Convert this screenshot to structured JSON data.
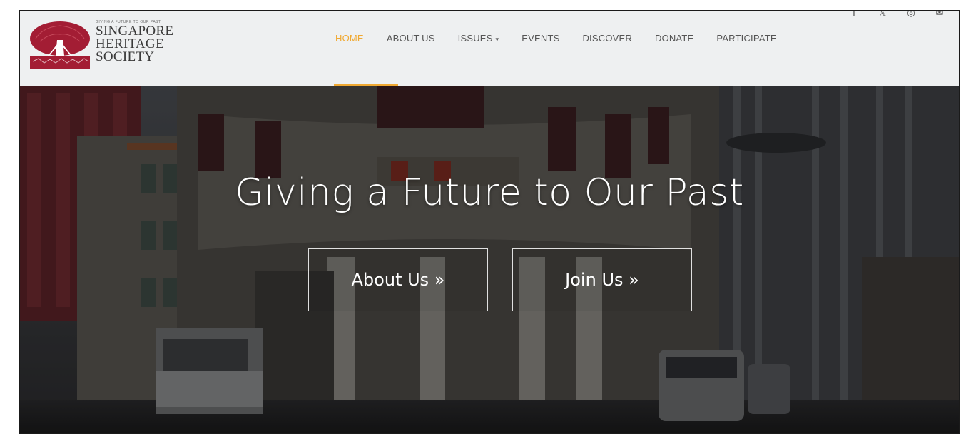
{
  "logo": {
    "tagline": "GIVING A FUTURE TO OUR PAST",
    "line1": "SINGAPORE",
    "line2": "HERITAGE",
    "line3": "SOCIETY",
    "colors": {
      "primary": "#a31d34"
    }
  },
  "nav": {
    "items": [
      {
        "label": "HOME",
        "active": true
      },
      {
        "label": "ABOUT US"
      },
      {
        "label": "ISSUES",
        "dropdown": true
      },
      {
        "label": "EVENTS"
      },
      {
        "label": "DISCOVER"
      },
      {
        "label": "DONATE"
      },
      {
        "label": "PARTICIPATE"
      }
    ],
    "active_color": "#f0a932",
    "chevron": "▾"
  },
  "social": [
    {
      "icon": "facebook-icon",
      "glyph": "f"
    },
    {
      "icon": "twitter-icon",
      "glyph": "𝕏"
    },
    {
      "icon": "instagram-icon",
      "glyph": "◎"
    },
    {
      "icon": "email-icon",
      "glyph": "✉"
    }
  ],
  "hero": {
    "title": "Giving a Future to Our Past",
    "buttons": {
      "about": "About Us »",
      "join": "Join Us »"
    }
  }
}
